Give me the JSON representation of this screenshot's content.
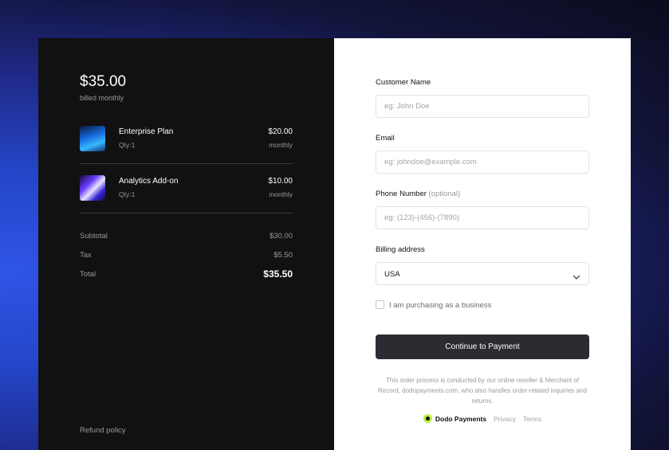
{
  "summary": {
    "total_amount": "$35.00",
    "billing_period": "billed monthly",
    "items": [
      {
        "name": "Enterprise Plan",
        "qty": "Qty:1",
        "price": "$20.00",
        "period": "monthly"
      },
      {
        "name": "Analytics Add-on",
        "qty": "Qty:1",
        "price": "$10.00",
        "period": "monthly"
      }
    ],
    "subtotal_label": "Subtotal",
    "subtotal_value": "$30.00",
    "tax_label": "Tax",
    "tax_value": "$5.50",
    "total_label": "Total",
    "total_value": "$35.50",
    "refund_policy": "Refund policy"
  },
  "form": {
    "name_label": "Customer Name",
    "name_placeholder": "eg: John Doe",
    "email_label": "Email",
    "email_placeholder": "eg: johndoe@example.com",
    "phone_label": "Phone Number",
    "phone_optional": "(optional)",
    "phone_placeholder": "eg: (123)-(456)-(7890)",
    "billing_label": "Billing address",
    "billing_value": "USA",
    "business_checkbox": "I am purchasing as a business",
    "submit_button": "Continue to Payment"
  },
  "footer": {
    "disclaimer": "This order process is conducted by our online reseller & Merchant of Record, dodopayments.com, who also handles order-related inquiries and returns.",
    "brand": "Dodo Payments",
    "privacy": "Privacy",
    "terms": "Terms"
  },
  "colors": {
    "left_panel_bg": "#111111",
    "button_bg": "#2b2b31",
    "brand_accent": "#b8f03c"
  }
}
